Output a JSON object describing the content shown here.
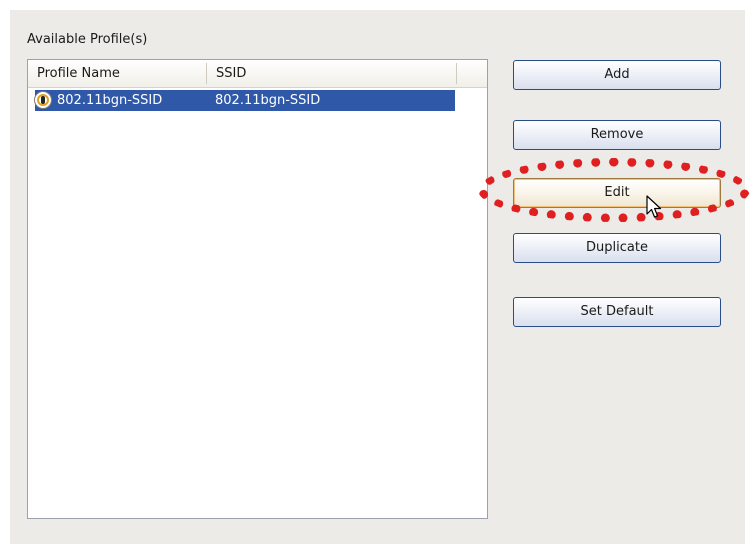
{
  "group": {
    "label": "Available Profile(s)"
  },
  "list": {
    "columns": [
      "Profile Name",
      "SSID"
    ],
    "rows": [
      {
        "profile_name": "802.11bgn-SSID",
        "ssid": "802.11bgn-SSID",
        "selected": true,
        "icon": "profile-icon"
      }
    ]
  },
  "buttons": {
    "add": "Add",
    "remove": "Remove",
    "edit": "Edit",
    "duplicate": "Duplicate",
    "set_default": "Set Default"
  },
  "colors": {
    "panel_bg": "#ecebe7",
    "selection": "#2f59a8",
    "highlight_annotation": "#e02020",
    "button_border": "#2a4d8a"
  }
}
